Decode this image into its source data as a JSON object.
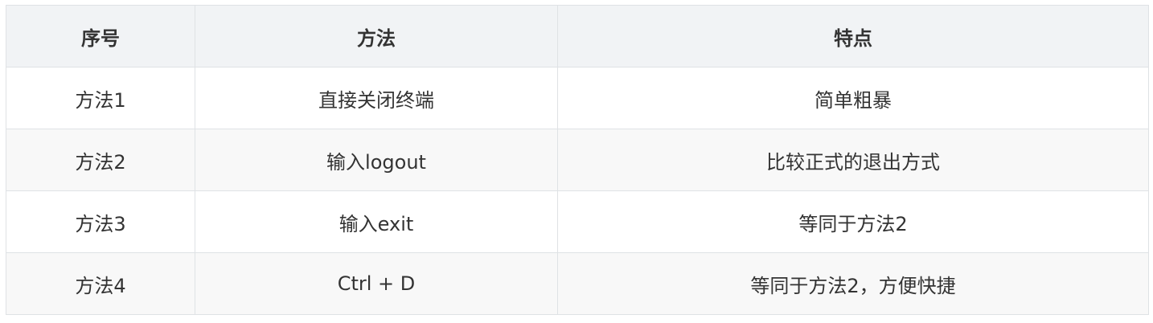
{
  "table": {
    "headers": [
      "序号",
      "方法",
      "特点"
    ],
    "rows": [
      [
        "方法1",
        "直接关闭终端",
        "简单粗暴"
      ],
      [
        "方法2",
        "输入logout",
        "比较正式的退出方式"
      ],
      [
        "方法3",
        "输入exit",
        "等同于方法2"
      ],
      [
        "方法4",
        "Ctrl + D",
        "等同于方法2，方便快捷"
      ]
    ]
  }
}
